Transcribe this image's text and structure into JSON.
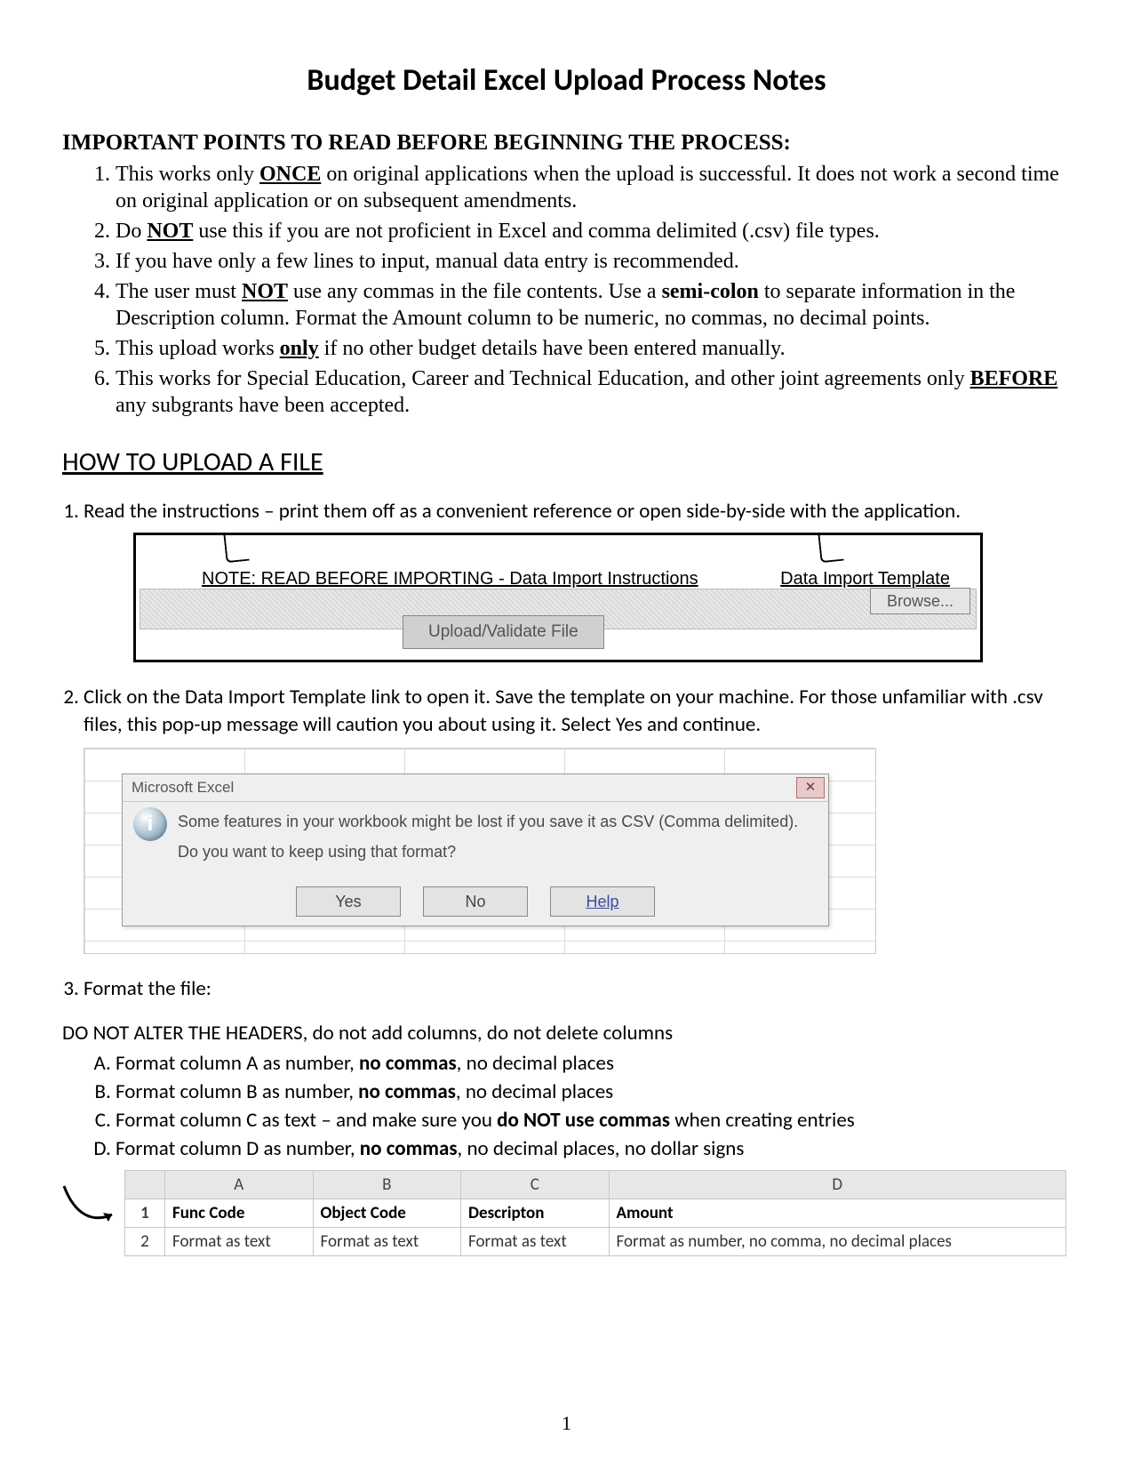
{
  "title": "Budget Detail Excel Upload Process Notes",
  "important_header": "IMPORTANT POINTS TO READ BEFORE BEGINNING THE PROCESS:",
  "important": [
    {
      "pre": "This works only ",
      "em": "ONCE",
      "post": " on original applications when the upload is successful.  It does not work a second time on original application or on subsequent amendments."
    },
    {
      "pre": "Do ",
      "em": "NOT",
      "post": " use this if you are not proficient in Excel and comma delimited (.csv) file types."
    },
    {
      "pre": "If you have only a few lines to input, manual data entry is recommended.",
      "em": "",
      "post": ""
    },
    {
      "pre": "The user must ",
      "em": "NOT",
      "post": " use any commas in the file contents.  Use a ",
      "b": "semi-colon",
      "post2": " to separate information in the Description column.  Format the Amount column to be numeric, no commas, no decimal points."
    },
    {
      "pre": "This upload works ",
      "em": "only",
      "post": " if no other budget details have been entered manually."
    },
    {
      "pre": "This works for Special Education, Career and Technical Education, and other joint agreements only ",
      "em": "BEFORE",
      "post": " any subgrants have been accepted."
    }
  ],
  "howto_header": "HOW TO UPLOAD A FILE",
  "steps": {
    "s1": "Read the instructions – print them off as a convenient reference or open side-by-side with the application.",
    "s2": "Click on the Data Import Template link to open it.  Save the template on your machine.  For those unfamiliar with .csv files, this pop-up message will caution you about using it.  Select Yes and continue.",
    "s3": "Format the file:",
    "s3_pre": "DO NOT ALTER THE HEADERS, do not add columns, do not delete columns",
    "s3_items": [
      {
        "pre": "Format column A as number, ",
        "b": "no commas",
        "post": ", no decimal places"
      },
      {
        "pre": "Format column B as number, ",
        "b": "no commas",
        "post": ", no decimal places"
      },
      {
        "pre": "Format column C as text – and make sure you ",
        "b": "do NOT use commas",
        "post": " when creating entries"
      },
      {
        "pre": "Format column D as number, ",
        "b": "no commas",
        "post": ", no decimal places, no dollar signs"
      }
    ]
  },
  "fig1": {
    "link_instr": "NOTE: READ BEFORE IMPORTING - Data Import Instructions",
    "link_tmpl": "Data Import Template",
    "browse": "Browse...",
    "upload": "Upload/Validate File"
  },
  "fig2": {
    "title": "Microsoft Excel",
    "close": "✕",
    "info_glyph": "i",
    "line1": "Some features in your workbook might be lost if you save it as CSV (Comma delimited).",
    "line2": "Do you want to keep using that format?",
    "yes": "Yes",
    "no": "No",
    "help": "Help"
  },
  "fig3": {
    "cols": [
      "A",
      "B",
      "C",
      "D"
    ],
    "row1": [
      "Func Code",
      "Object Code",
      "Descripton",
      "Amount"
    ],
    "row2": [
      "Format as text",
      "Format as text",
      "Format as text",
      "Format as number, no comma, no decimal places"
    ]
  },
  "page_number": "1"
}
